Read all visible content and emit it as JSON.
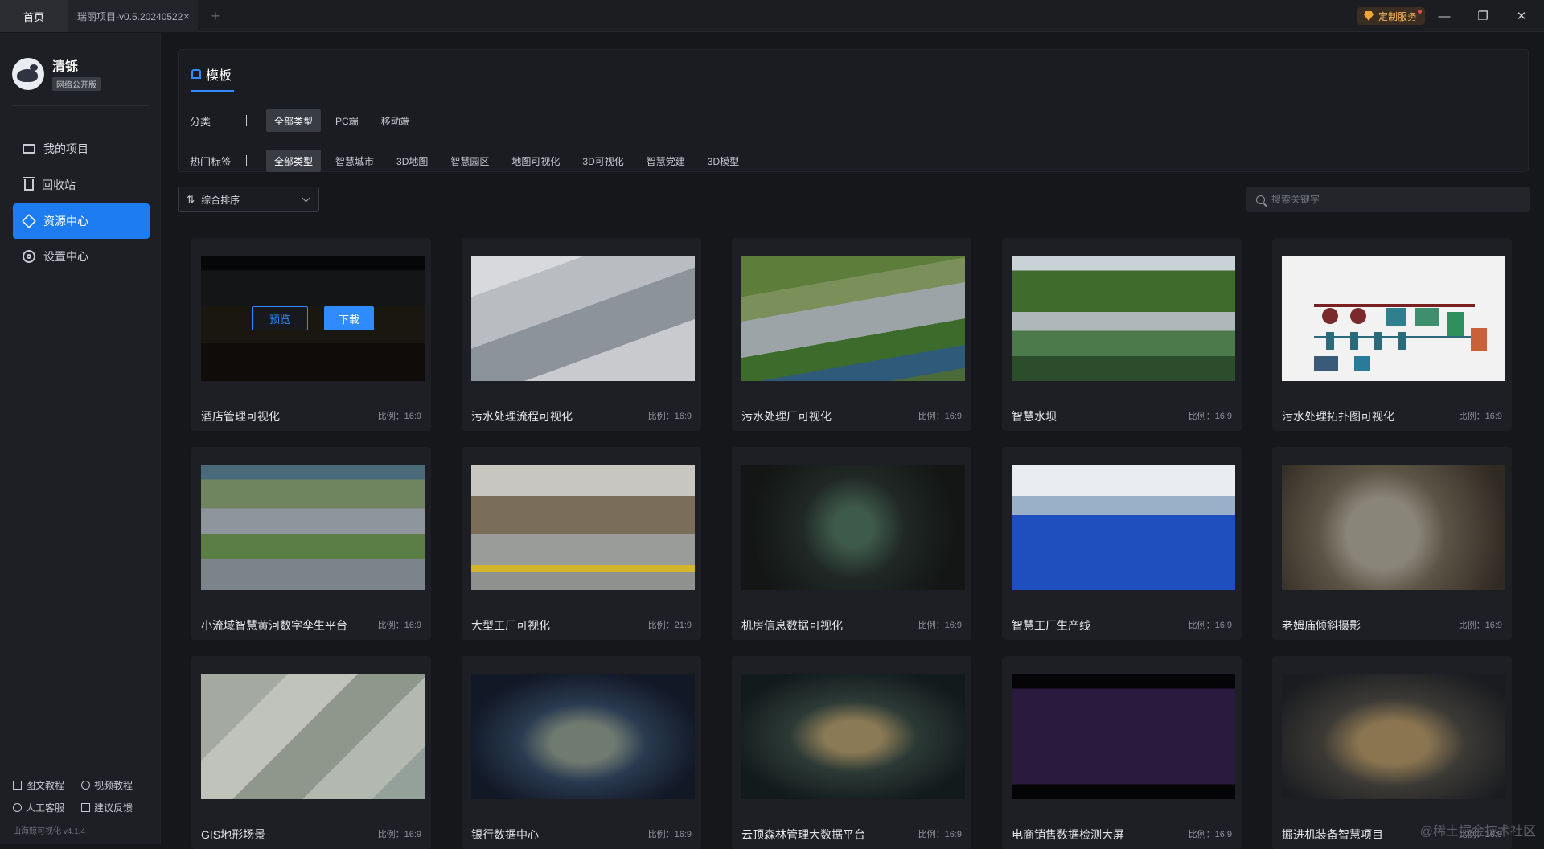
{
  "titlebar": {
    "tabs": [
      {
        "label": "首页"
      },
      {
        "label": "瑞丽项目-v0.5.20240522"
      }
    ],
    "close_tab": "×",
    "add_tab": "+",
    "service_label": "定制服务",
    "min": "—",
    "restore": "❐",
    "close": "✕"
  },
  "sidebar": {
    "user": {
      "name": "清铄",
      "badge": "网络公开版"
    },
    "items": [
      {
        "label": "我的项目",
        "icon": "monitor-icon"
      },
      {
        "label": "回收站",
        "icon": "trash-icon"
      },
      {
        "label": "资源中心",
        "icon": "cube-icon",
        "active": true
      },
      {
        "label": "设置中心",
        "icon": "gear-icon"
      }
    ],
    "footer": {
      "doc_tutorial": "图文教程",
      "video_tutorial": "视频教程",
      "support": "人工客服",
      "feedback": "建议反馈",
      "version": "山海鲸可视化 v4.1.4"
    }
  },
  "main": {
    "panel_title": "模板",
    "category": {
      "label": "分类",
      "options": [
        "全部类型",
        "PC端",
        "移动端"
      ],
      "selected": "全部类型"
    },
    "hot_tags": {
      "label": "热门标签",
      "options": [
        "全部类型",
        "智慧城市",
        "3D地图",
        "智慧园区",
        "地图可视化",
        "3D可视化",
        "智慧党建",
        "3D模型"
      ],
      "selected": "全部类型"
    },
    "sort": {
      "label": "综合排序"
    },
    "search": {
      "placeholder": "搜索关键字"
    },
    "hover_actions": {
      "preview": "预览",
      "download": "下载"
    },
    "cards": [
      {
        "title": "酒店管理可视化",
        "ratio": "比例：16:9"
      },
      {
        "title": "污水处理流程可视化",
        "ratio": "比例：16:9"
      },
      {
        "title": "污水处理厂可视化",
        "ratio": "比例：16:9"
      },
      {
        "title": "智慧水坝",
        "ratio": "比例：16:9"
      },
      {
        "title": "污水处理拓扑图可视化",
        "ratio": "比例：16:9"
      },
      {
        "title": "小流域智慧黄河数字孪生平台",
        "ratio": "比例：16:9"
      },
      {
        "title": "大型工厂可视化",
        "ratio": "比例：21:9"
      },
      {
        "title": "机房信息数据可视化",
        "ratio": "比例：16:9"
      },
      {
        "title": "智慧工厂生产线",
        "ratio": "比例：16:9"
      },
      {
        "title": "老姆庙倾斜摄影",
        "ratio": "比例：16:9"
      },
      {
        "title": "GIS地形场景",
        "ratio": "比例：16:9"
      },
      {
        "title": "银行数据中心",
        "ratio": "比例：16:9"
      },
      {
        "title": "云顶森林管理大数据平台",
        "ratio": "比例：16:9"
      },
      {
        "title": "电商销售数据检测大屏",
        "ratio": "比例：16:9"
      },
      {
        "title": "掘进机装备智慧项目",
        "ratio": "比例：16:9"
      }
    ],
    "watermark": "@稀土掘金技术社区"
  }
}
